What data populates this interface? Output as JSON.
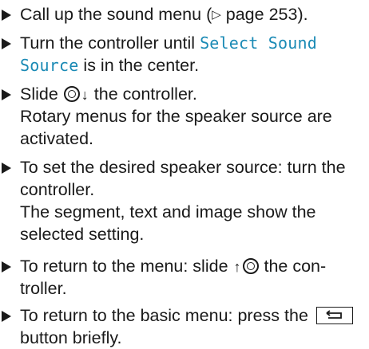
{
  "steps": [
    {
      "lines": [
        "Call up the sound menu (",
        "page 253)."
      ],
      "ref_symbol": "▷"
    },
    {
      "line1_prefix": "Turn the controller until ",
      "term_part1": "Select Sound",
      "term_part2": "Source",
      "line2_suffix": " is in the center."
    },
    {
      "line1_prefix": "Slide ",
      "line1_suffix": " the controller.",
      "result": [
        "Rotary menus for the speaker source are",
        "activated."
      ]
    },
    {
      "lines": [
        "To set the desired speaker source: turn the",
        "controller."
      ],
      "result": [
        "The segment, text and image show the",
        "selected setting."
      ]
    },
    {
      "line1_prefix": "To return to the menu: slide ",
      "line1_suffix": " the con-",
      "line2": "troller."
    },
    {
      "line1": "To return to the basic menu: press the ",
      "line2": "button briefly."
    }
  ],
  "glyphs": {
    "slide_down": "↓",
    "slide_up": "↑"
  },
  "colors": {
    "display_term": "#1a8ab5",
    "text": "#1a1a1a"
  },
  "icons": {
    "bullet": "triangle-bullet-icon",
    "controller": "controller-icon",
    "back_button": "back-button-icon"
  }
}
